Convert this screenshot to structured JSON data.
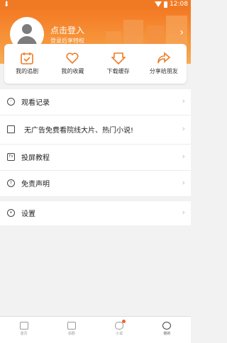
{
  "status_bar": {
    "time": "12:08",
    "download_icon": "download-icon"
  },
  "profile": {
    "title": "点击登入",
    "subtitle": "登录后享特权"
  },
  "quick_actions": [
    {
      "label": "我的追剧",
      "icon": "calendar-check-icon"
    },
    {
      "label": "我的收藏",
      "icon": "heart-icon"
    },
    {
      "label": "下载缓存",
      "icon": "download-arrow-icon"
    },
    {
      "label": "分享给朋友",
      "icon": "share-icon"
    }
  ],
  "menu": [
    {
      "label": "观看记录",
      "icon": "clock-icon"
    },
    {
      "label": "无广告免费看院线大片、热门小说!",
      "icon": "book-icon"
    },
    {
      "label": "投屏教程",
      "icon": "tv-icon"
    },
    {
      "label": "免责声明",
      "icon": "info-icon"
    }
  ],
  "settings": {
    "label": "设置",
    "icon": "gear-icon"
  },
  "tabs": [
    {
      "label": "首页",
      "icon": "home-icon"
    },
    {
      "label": "追剧",
      "icon": "tv-tab-icon"
    },
    {
      "label": "小说",
      "icon": "message-icon"
    },
    {
      "label": "我的",
      "icon": "profile-icon"
    }
  ],
  "colors": {
    "accent": "#f07a24",
    "badge": "#f0612d"
  }
}
